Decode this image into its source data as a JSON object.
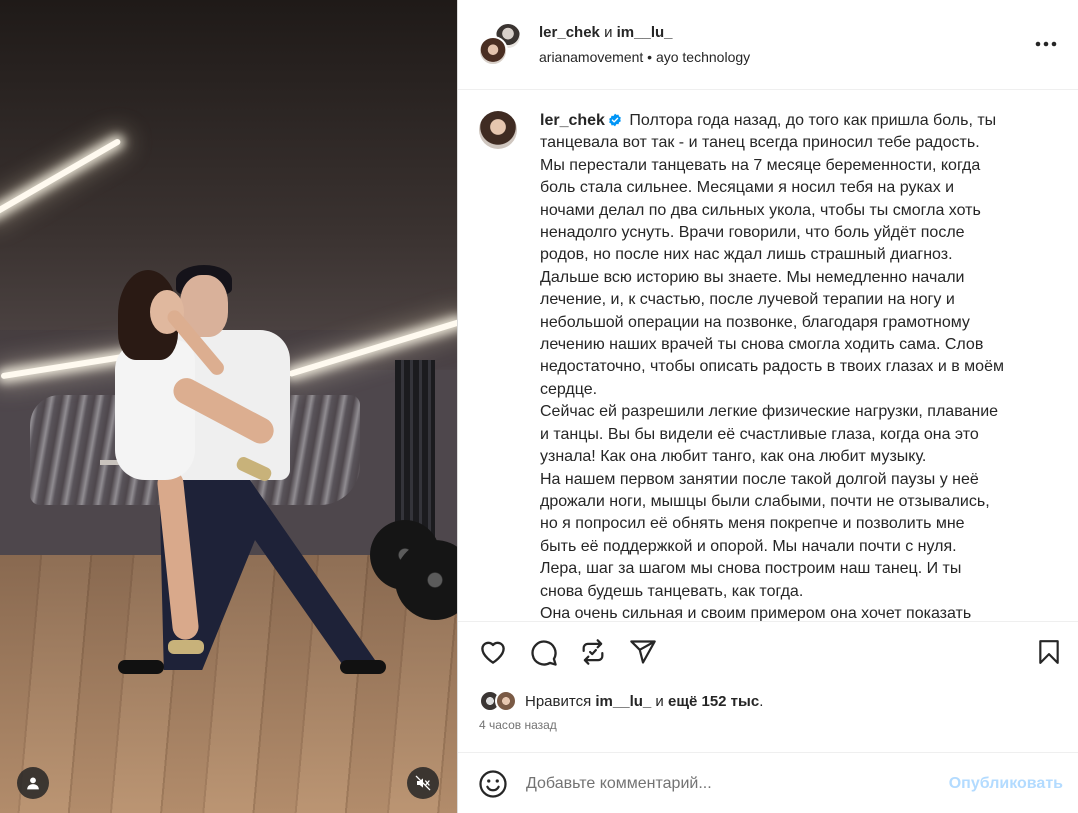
{
  "header": {
    "user1": "ler_chek",
    "conjunction": "и",
    "user2": "im__lu_",
    "subtitle": "arianamovement • ayo technology"
  },
  "caption": {
    "username": "ler_chek",
    "lines": [
      "Полтора года назад, до того как пришла боль, ты",
      "танцевала вот так - и танец всегда приносил тебе радость.",
      "Мы перестали танцевать на 7 месяце беременности, когда",
      "боль стала сильнее. Месяцами я носил тебя на руках и",
      "ночами делал по два сильных укола, чтобы ты смогла хоть",
      "ненадолго уснуть. Врачи говорили, что боль уйдёт после",
      "родов, но после них нас ждал лишь страшный диагноз.",
      "Дальше всю историю вы знаете. Мы немедленно начали",
      "лечение, и, к счастью, после лучевой терапии на ногу и",
      "небольшой операции на позвонке, благодаря грамотному",
      "лечению наших врачей ты снова смогла ходить сама. Слов",
      "недостаточно, чтобы описать радость в твоих глазах и в моём",
      "сердце.",
      "Сейчас ей разрешили легкие физические нагрузки, плавание",
      "и танцы. Вы бы видели её счастливые глаза, когда она это",
      "узнала! Как она любит танго, как она любит музыку.",
      "На нашем первом занятии после такой долгой паузы у неё",
      "дрожали ноги, мышцы были слабыми, почти не отзывались,",
      "но я попросил её обнять меня покрепче и позволить мне",
      "быть её поддержкой и опорой. Мы начали почти с нуля.",
      "Лера, шаг за шагом мы снова построим наш танец. И ты",
      "снова будешь танцевать, как тогда.",
      "Она очень сильная и своим примером она хочет показать"
    ]
  },
  "likes": {
    "prefix": "Нравится",
    "user": "im__lu_",
    "middle": "и",
    "count": "ещё 152 тыс",
    "suffix": "."
  },
  "time": "4 часов назад",
  "comment": {
    "placeholder": "Добавьте комментарий...",
    "publish": "Опубликовать"
  },
  "icons": {
    "more": "more-options-icon",
    "like": "heart-icon",
    "comment": "comment-icon",
    "repost": "repost-icon",
    "share": "share-icon",
    "save": "bookmark-icon",
    "emoji": "emoji-icon",
    "tagged": "user-icon",
    "mute": "speaker-muted-icon"
  },
  "colors": {
    "text": "#262626",
    "secondary": "#737373",
    "verified": "#0095f6",
    "publish_disabled": "#b3dbff"
  }
}
